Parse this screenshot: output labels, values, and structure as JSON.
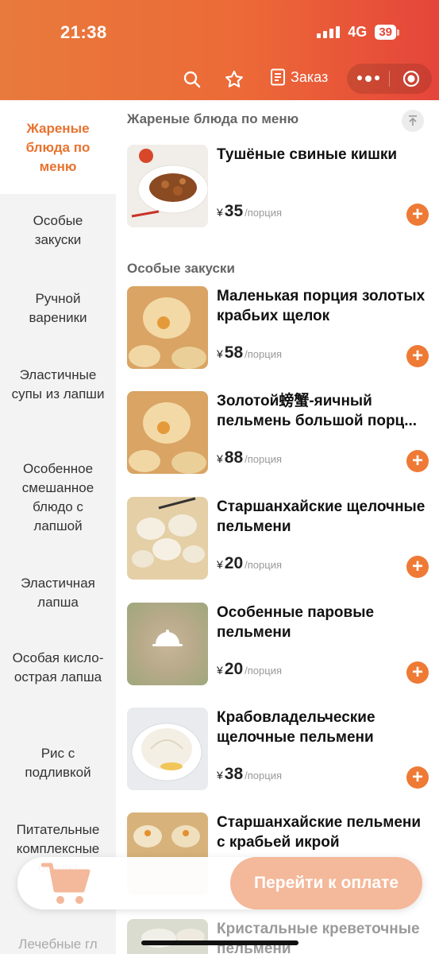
{
  "status": {
    "time": "21:38",
    "network": "4G",
    "battery": "39"
  },
  "toolbar": {
    "order_label": "Заказ"
  },
  "sidebar": {
    "items": [
      {
        "label": "Жареные блюда по меню",
        "active": true
      },
      {
        "label": "Особые закуски"
      },
      {
        "label": "Ручной вареники"
      },
      {
        "label": "Эластичные супы из лапши"
      },
      {
        "label": "Особенное смешанное блюдо с лапшой"
      },
      {
        "label": "Эластичная лапша"
      },
      {
        "label": "Особая кисло-острая лапша"
      },
      {
        "label": "Рис с подливкой"
      },
      {
        "label": "Питательные комплексные обеды"
      },
      {
        "label": "Лечебные гл"
      }
    ]
  },
  "sections": [
    {
      "title": "Жареные блюда по меню"
    },
    {
      "title": "Особые закуски"
    }
  ],
  "items": [
    {
      "name": "Тушёные свиные кишки",
      "currency": "¥",
      "price": "35",
      "unit": "/порция"
    },
    {
      "name": "Маленькая порция золотых крабьих щелок",
      "currency": "¥",
      "price": "58",
      "unit": "/порция"
    },
    {
      "name": "Золотой螃蟹-яичный пельмень большой порц...",
      "currency": "¥",
      "price": "88",
      "unit": "/порция"
    },
    {
      "name": "Старшанхайские щелочные пельмени",
      "currency": "¥",
      "price": "20",
      "unit": "/порция"
    },
    {
      "name": "Особенные паровые пельмени",
      "currency": "¥",
      "price": "20",
      "unit": "/порция"
    },
    {
      "name": "Крабовладельческие щелочные пельмени",
      "currency": "¥",
      "price": "38",
      "unit": "/порция"
    },
    {
      "name": "Старшанхайские пельмени с крабьей икрой",
      "currency": "¥",
      "price": "",
      "unit": ""
    },
    {
      "name": "Кристальные креветочные пельмени",
      "currency": "",
      "price": "",
      "unit": ""
    }
  ],
  "cart": {
    "pay_label": "Перейти к оплате"
  },
  "colors": {
    "accent": "#ee7a35",
    "header_start": "#e87a3c",
    "header_end": "#e5453a"
  }
}
